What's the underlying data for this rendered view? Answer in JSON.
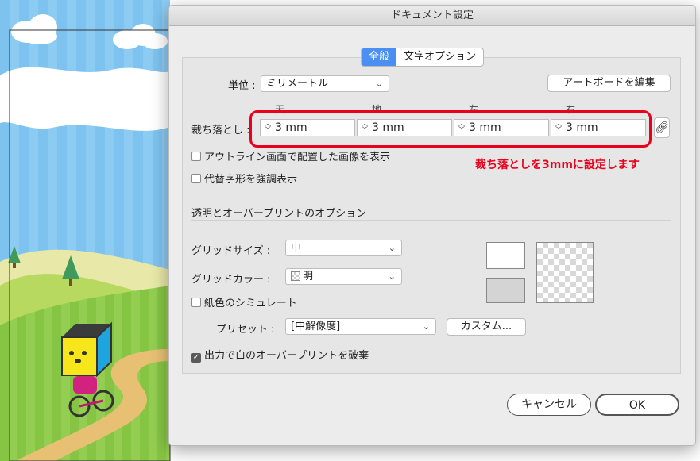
{
  "dialog": {
    "title": "ドキュメント設定"
  },
  "tabs": [
    {
      "label": "全般"
    },
    {
      "label": "文字オプション"
    }
  ],
  "units": {
    "label": "単位 :",
    "value": "ミリメートル"
  },
  "artboard_button": "アートボードを編集",
  "bleed": {
    "label": "裁ち落とし :",
    "columns": [
      {
        "header": "天",
        "value": "3 mm"
      },
      {
        "header": "地",
        "value": "3 mm"
      },
      {
        "header": "左",
        "value": "3 mm"
      },
      {
        "header": "右",
        "value": "3 mm"
      }
    ]
  },
  "annotation": "裁ち落としを3mmに設定します",
  "checkboxes": {
    "outline_images": {
      "label": "アウトライン画面で配置した画像を表示",
      "checked": false
    },
    "substitute_glyphs": {
      "label": "代替字形を強調表示",
      "checked": false
    }
  },
  "transparency": {
    "section_title": "透明とオーバープリントのオプション",
    "grid_size": {
      "label": "グリッドサイズ :",
      "value": "中"
    },
    "grid_color": {
      "label": "グリッドカラー :",
      "value": "明"
    },
    "paper_simulation": {
      "label": "紙色のシミュレート",
      "checked": false
    },
    "preset": {
      "label": "プリセット :",
      "value": "[中解像度]"
    },
    "custom_button": "カスタム...",
    "discard_white_overprint": {
      "label": "出力で白のオーバープリントを破棄",
      "checked": true
    }
  },
  "footer": {
    "cancel": "キャンセル",
    "ok": "OK"
  },
  "colors": {
    "accent": "#4a8ff1",
    "annotation": "#e8001c"
  }
}
